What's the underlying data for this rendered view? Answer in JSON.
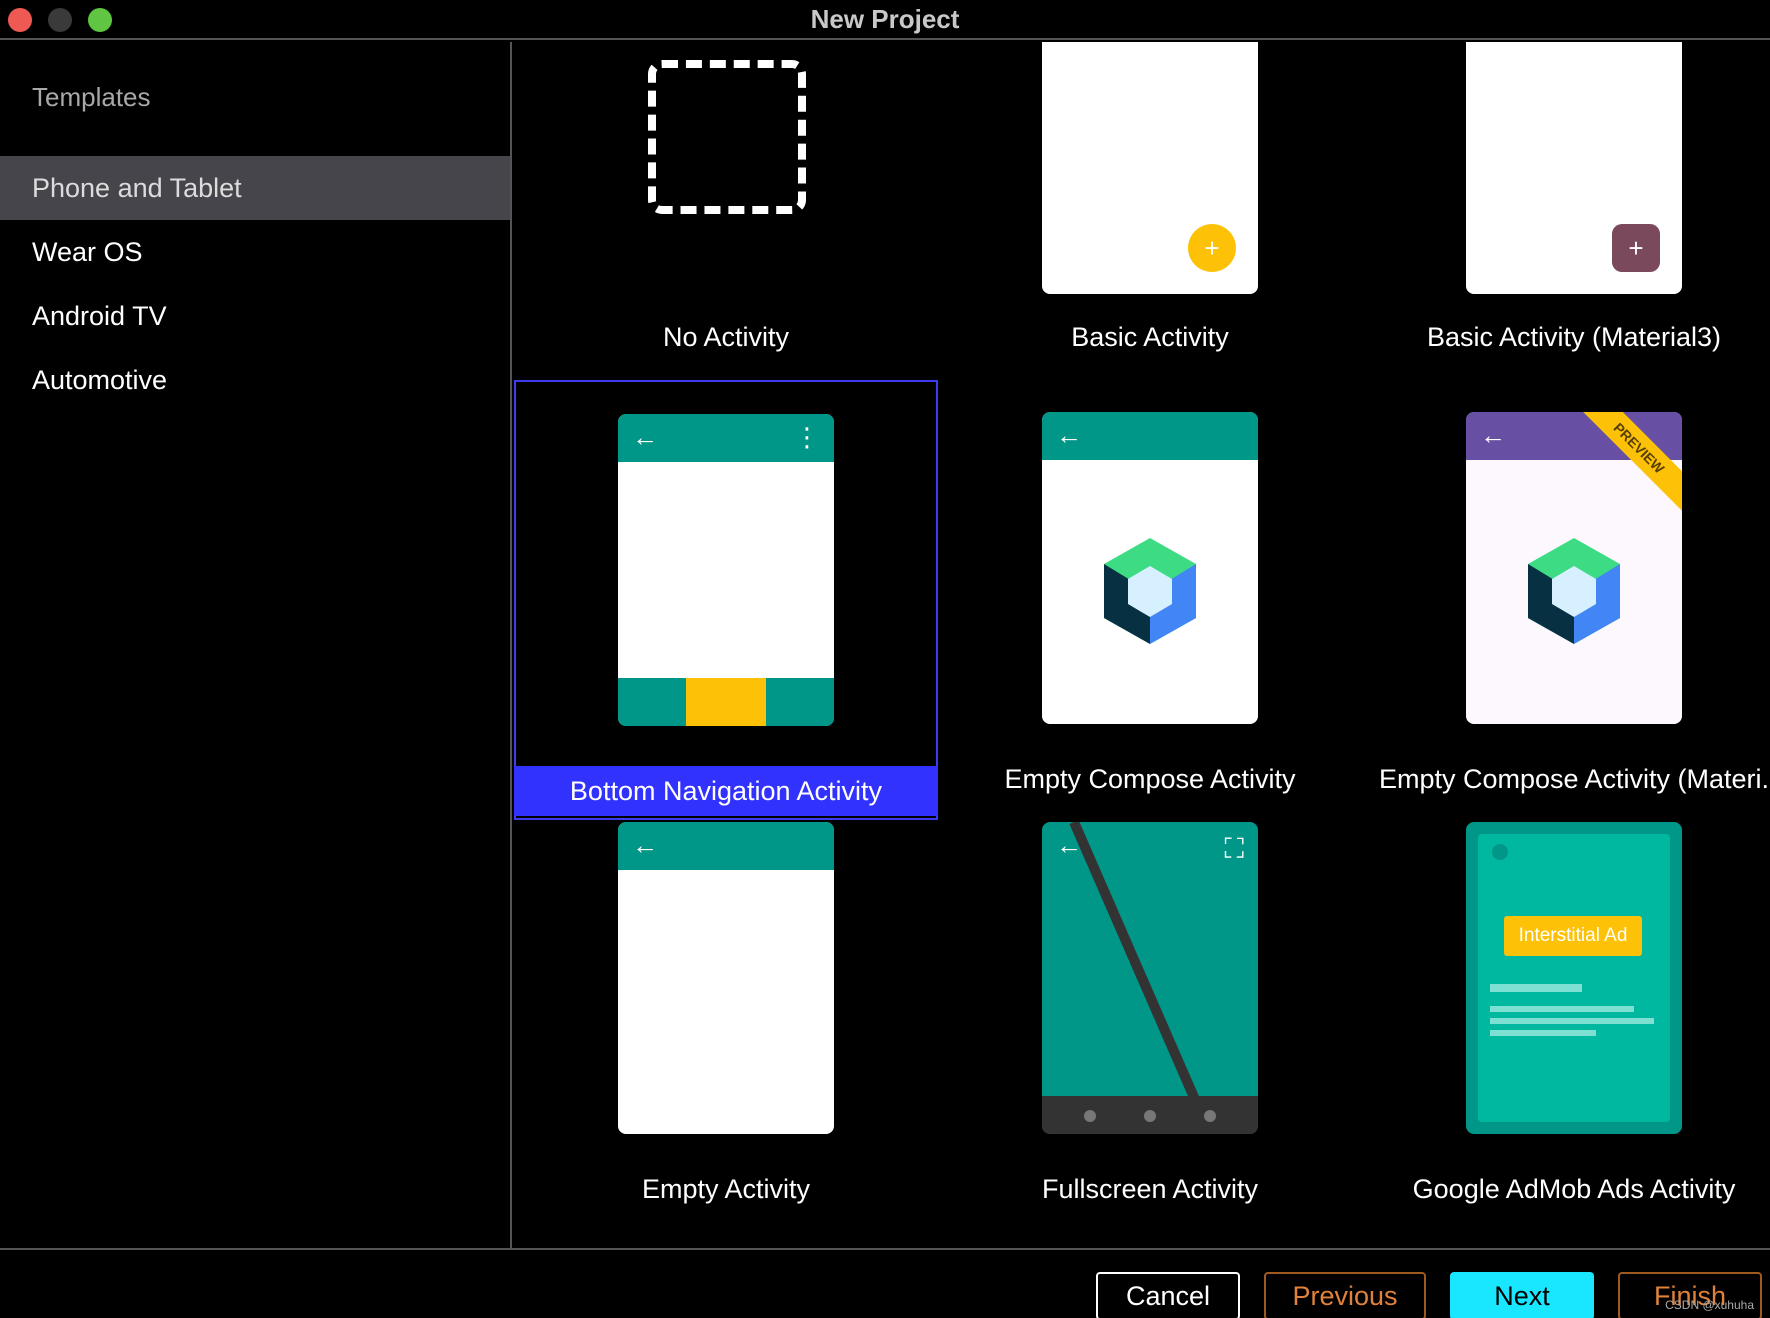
{
  "window": {
    "title": "New Project"
  },
  "sidebar": {
    "header": "Templates",
    "items": [
      {
        "label": "Phone and Tablet",
        "selected": true
      },
      {
        "label": "Wear OS",
        "selected": false
      },
      {
        "label": "Android TV",
        "selected": false
      },
      {
        "label": "Automotive",
        "selected": false
      }
    ]
  },
  "templates": [
    {
      "label": "No Activity"
    },
    {
      "label": "Basic Activity",
      "fab": "+"
    },
    {
      "label": "Basic Activity (Material3)",
      "fab": "+"
    },
    {
      "label": "Bottom Navigation Activity",
      "selected": true
    },
    {
      "label": "Empty Compose Activity"
    },
    {
      "label": "Empty Compose Activity (Materi.",
      "ribbon": "PREVIEW"
    },
    {
      "label": "Empty Activity"
    },
    {
      "label": "Fullscreen Activity"
    },
    {
      "label": "Google AdMob Ads Activity",
      "badge": "Interstitial Ad"
    }
  ],
  "colors": {
    "teal": "#009688",
    "amber": "#fdc207",
    "purple": "#6750a4",
    "selection": "#3232ff",
    "next": "#19e6ff"
  },
  "footer": {
    "cancel": "Cancel",
    "previous": "Previous",
    "next": "Next",
    "finish": "Finish",
    "watermark": "CSDN @xuhuha"
  }
}
